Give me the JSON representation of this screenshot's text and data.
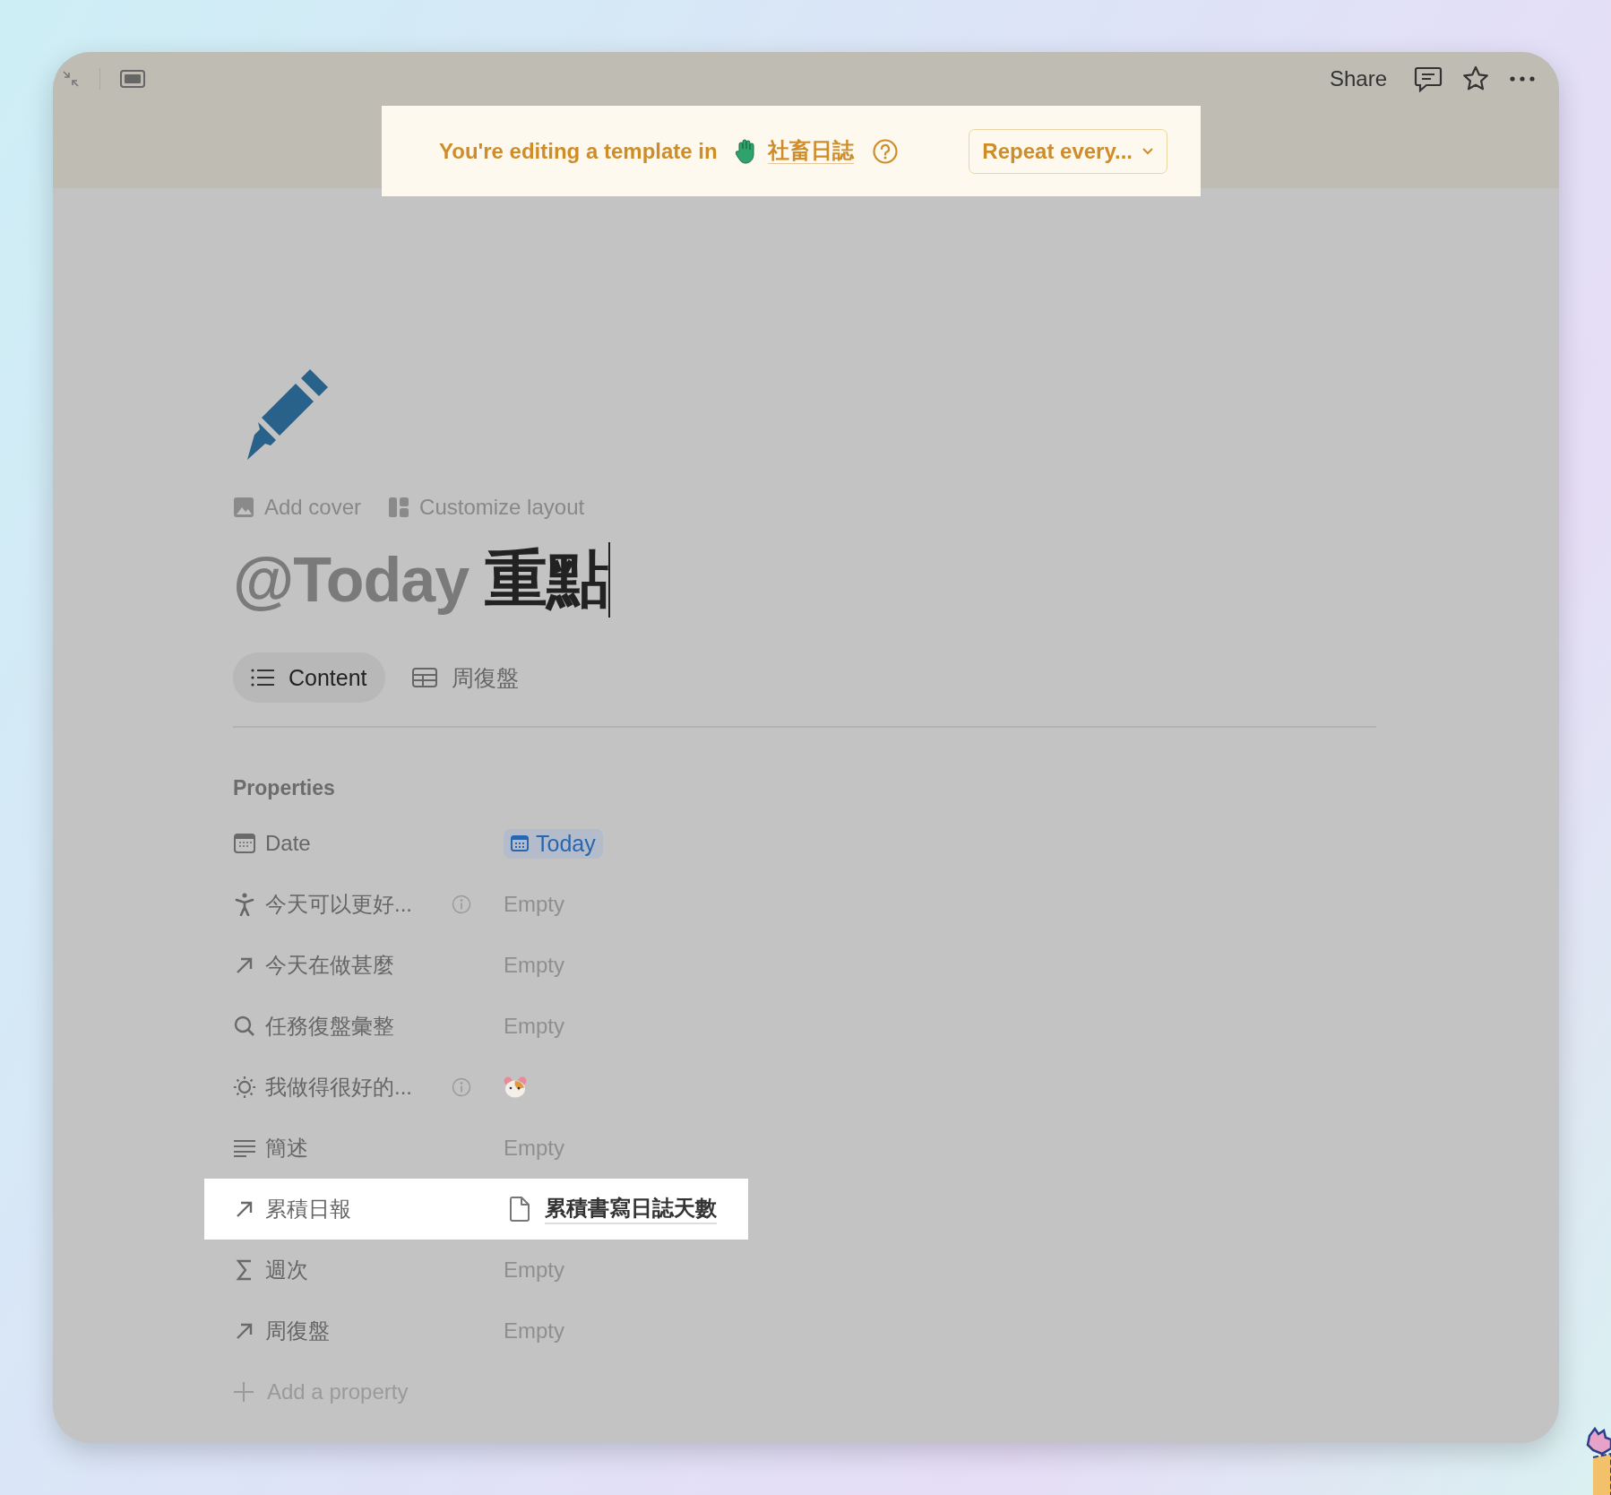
{
  "toolbar": {
    "share": "Share"
  },
  "banner": {
    "text": "You're editing a template in",
    "database": "社畜日誌",
    "repeat": "Repeat every..."
  },
  "page": {
    "add_cover": "Add cover",
    "customize_layout": "Customize layout",
    "title_mention": "@Today",
    "title_text": "重點"
  },
  "tabs": [
    {
      "label": "Content",
      "kind": "list",
      "selected": true
    },
    {
      "label": "周復盤",
      "kind": "table",
      "selected": false
    }
  ],
  "properties_heading": "Properties",
  "properties": [
    {
      "name": "Date",
      "kind": "date",
      "value": "Today",
      "info": false,
      "highlighted": false
    },
    {
      "name": "今天可以更好...",
      "kind": "text",
      "value": "Empty",
      "info": true,
      "highlighted": false
    },
    {
      "name": "今天在做甚麼",
      "kind": "text",
      "value": "Empty",
      "info": false,
      "highlighted": false
    },
    {
      "name": "任務復盤彙整",
      "kind": "text",
      "value": "Empty",
      "info": false,
      "highlighted": false
    },
    {
      "name": "我做得很好的...",
      "kind": "emoji",
      "info": true,
      "highlighted": false
    },
    {
      "name": "簡述",
      "kind": "text",
      "value": "Empty",
      "info": false,
      "highlighted": false
    },
    {
      "name": "累積日報",
      "kind": "page",
      "value": "累積書寫日誌天數",
      "info": false,
      "highlighted": true
    },
    {
      "name": "週次",
      "kind": "text",
      "value": "Empty",
      "info": false,
      "highlighted": false
    },
    {
      "name": "周復盤",
      "kind": "text",
      "value": "Empty",
      "info": false,
      "highlighted": false
    }
  ],
  "add_property": "Add a property"
}
